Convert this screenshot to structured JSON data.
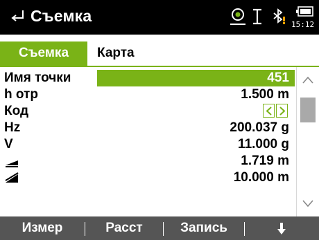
{
  "header": {
    "title": "Съемка",
    "clock": "15:12",
    "icons": [
      "back-arrow-icon",
      "target-icon",
      "cursor-icon",
      "bluetooth-icon",
      "battery-icon"
    ]
  },
  "tabs": [
    {
      "label": "Съемка",
      "active": true
    },
    {
      "label": "Карта",
      "active": false
    }
  ],
  "fields": {
    "point_name": {
      "label": "Имя точки",
      "value": "451"
    },
    "target_height": {
      "label": "h отр",
      "value": "1.500 m"
    },
    "code": {
      "label": "Код",
      "value": ""
    },
    "hz": {
      "label": "Hz",
      "value": "200.037 g"
    },
    "v": {
      "label": "V",
      "value": "11.000 g"
    },
    "horizontal_distance": {
      "icon": "horizontal-distance-icon",
      "value": "1.719 m"
    },
    "slope_distance": {
      "icon": "slope-distance-icon",
      "value": "10.000 m"
    }
  },
  "softkeys": [
    {
      "label": "Измер"
    },
    {
      "label": "Расст"
    },
    {
      "label": "Запись"
    },
    {
      "label": "",
      "icon": "arrow-down-icon"
    }
  ],
  "colors": {
    "accent": "#7ab317",
    "header_bg": "#000000",
    "softkey_bg": "#555555",
    "scroll_thumb": "#a9a9a9",
    "battery_warn": "#f0a000"
  }
}
